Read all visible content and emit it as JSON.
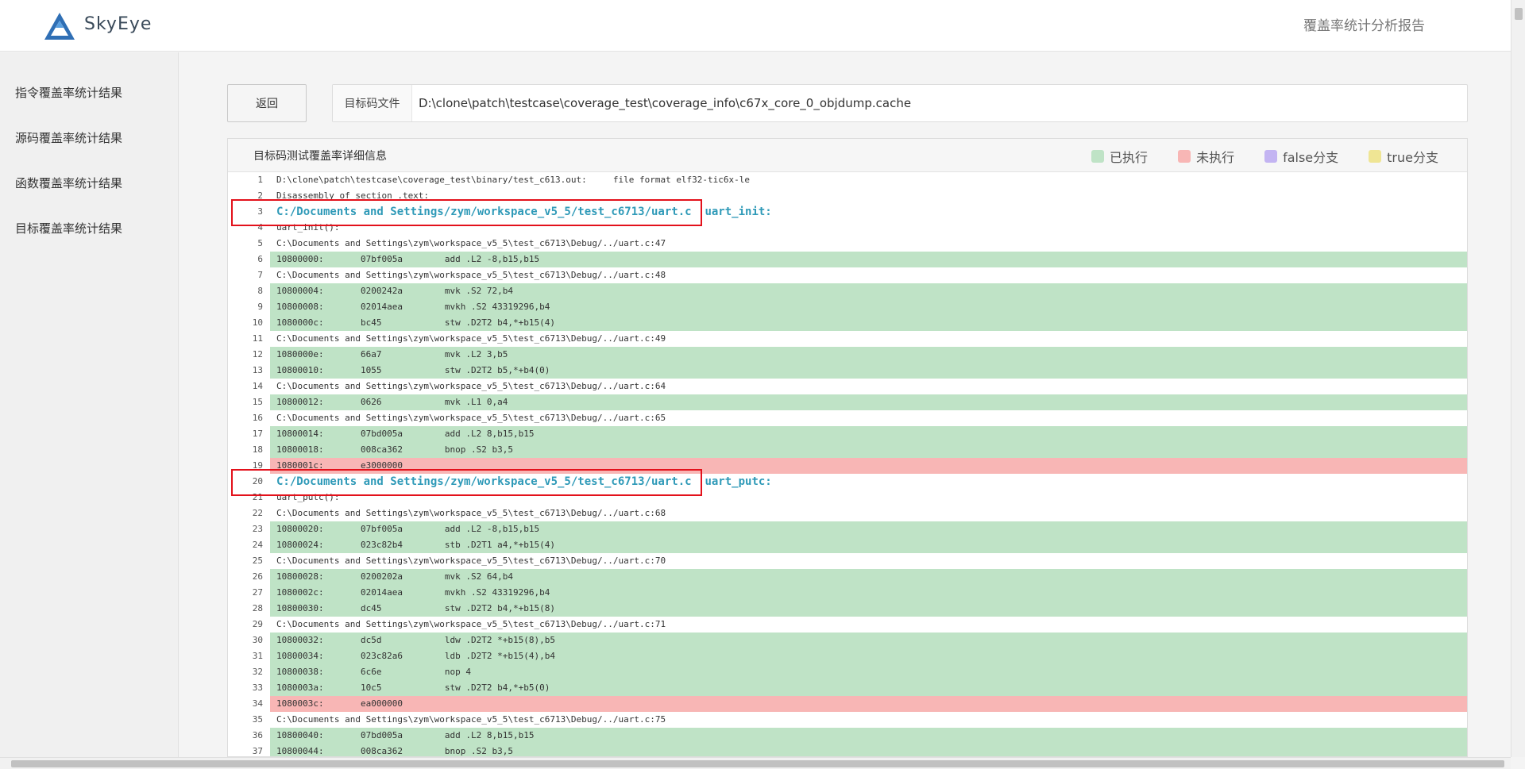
{
  "header": {
    "brand": "SkyEye",
    "report_title": "覆盖率统计分析报告"
  },
  "sidebar": {
    "items": [
      {
        "label": "指令覆盖率统计结果"
      },
      {
        "label": "源码覆盖率统计结果"
      },
      {
        "label": "函数覆盖率统计结果"
      },
      {
        "label": "目标覆盖率统计结果"
      }
    ]
  },
  "toolbar": {
    "back_label": "返回",
    "file_label": "目标码文件",
    "file_path": "D:\\clone\\patch\\testcase\\coverage_test\\coverage_info\\c67x_core_0_objdump.cache"
  },
  "panel": {
    "title": "目标码测试覆盖率详细信息",
    "legend": [
      {
        "label": "已执行",
        "color": "#bfe3c6"
      },
      {
        "label": "未执行",
        "color": "#f8b6b5"
      },
      {
        "label": "false分支",
        "color": "#c3b4f2"
      },
      {
        "label": "true分支",
        "color": "#efe594"
      }
    ]
  },
  "colors": {
    "executed": "#bfe3c6",
    "not_executed": "#f8b6b5",
    "highlight_border": "#e3111b",
    "function_text": "#2f9ab8"
  },
  "code_lines": [
    {
      "n": "1",
      "t": "D:\\clone\\patch\\testcase\\coverage_test\\binary/test_c613.out:     file format elf32-tic6x-le",
      "s": "plain"
    },
    {
      "n": "2",
      "t": "Disassembly of section .text:",
      "s": "plain"
    },
    {
      "n": "3",
      "t": "C:/Documents and Settings/zym/workspace_v5_5/test_c6713/uart.c  uart_init:",
      "s": "func"
    },
    {
      "n": "4",
      "t": "uart_init():",
      "s": "plain"
    },
    {
      "n": "5",
      "t": "C:\\Documents and Settings\\zym\\workspace_v5_5\\test_c6713\\Debug/../uart.c:47",
      "s": "plain"
    },
    {
      "n": "6",
      "t": "10800000:       07bf005a        add .L2 -8,b15,b15",
      "s": "exec"
    },
    {
      "n": "7",
      "t": "C:\\Documents and Settings\\zym\\workspace_v5_5\\test_c6713\\Debug/../uart.c:48",
      "s": "plain"
    },
    {
      "n": "8",
      "t": "10800004:       0200242a        mvk .S2 72,b4",
      "s": "exec"
    },
    {
      "n": "9",
      "t": "10800008:       02014aea        mvkh .S2 43319296,b4",
      "s": "exec"
    },
    {
      "n": "10",
      "t": "1080000c:       bc45            stw .D2T2 b4,*+b15(4)",
      "s": "exec"
    },
    {
      "n": "11",
      "t": "C:\\Documents and Settings\\zym\\workspace_v5_5\\test_c6713\\Debug/../uart.c:49",
      "s": "plain"
    },
    {
      "n": "12",
      "t": "1080000e:       66a7            mvk .L2 3,b5",
      "s": "exec"
    },
    {
      "n": "13",
      "t": "10800010:       1055            stw .D2T2 b5,*+b4(0)",
      "s": "exec"
    },
    {
      "n": "14",
      "t": "C:\\Documents and Settings\\zym\\workspace_v5_5\\test_c6713\\Debug/../uart.c:64",
      "s": "plain"
    },
    {
      "n": "15",
      "t": "10800012:       0626            mvk .L1 0,a4",
      "s": "exec"
    },
    {
      "n": "16",
      "t": "C:\\Documents and Settings\\zym\\workspace_v5_5\\test_c6713\\Debug/../uart.c:65",
      "s": "plain"
    },
    {
      "n": "17",
      "t": "10800014:       07bd005a        add .L2 8,b15,b15",
      "s": "exec"
    },
    {
      "n": "18",
      "t": "10800018:       008ca362        bnop .S2 b3,5",
      "s": "exec"
    },
    {
      "n": "19",
      "t": "1080001c:       e3000000",
      "s": "noexec"
    },
    {
      "n": "20",
      "t": "C:/Documents and Settings/zym/workspace_v5_5/test_c6713/uart.c  uart_putc:",
      "s": "func"
    },
    {
      "n": "21",
      "t": "uart_putc():",
      "s": "plain"
    },
    {
      "n": "22",
      "t": "C:\\Documents and Settings\\zym\\workspace_v5_5\\test_c6713\\Debug/../uart.c:68",
      "s": "plain"
    },
    {
      "n": "23",
      "t": "10800020:       07bf005a        add .L2 -8,b15,b15",
      "s": "exec"
    },
    {
      "n": "24",
      "t": "10800024:       023c82b4        stb .D2T1 a4,*+b15(4)",
      "s": "exec"
    },
    {
      "n": "25",
      "t": "C:\\Documents and Settings\\zym\\workspace_v5_5\\test_c6713\\Debug/../uart.c:70",
      "s": "plain"
    },
    {
      "n": "26",
      "t": "10800028:       0200202a        mvk .S2 64,b4",
      "s": "exec"
    },
    {
      "n": "27",
      "t": "1080002c:       02014aea        mvkh .S2 43319296,b4",
      "s": "exec"
    },
    {
      "n": "28",
      "t": "10800030:       dc45            stw .D2T2 b4,*+b15(8)",
      "s": "exec"
    },
    {
      "n": "29",
      "t": "C:\\Documents and Settings\\zym\\workspace_v5_5\\test_c6713\\Debug/../uart.c:71",
      "s": "plain"
    },
    {
      "n": "30",
      "t": "10800032:       dc5d            ldw .D2T2 *+b15(8),b5",
      "s": "exec"
    },
    {
      "n": "31",
      "t": "10800034:       023c82a6        ldb .D2T2 *+b15(4),b4",
      "s": "exec"
    },
    {
      "n": "32",
      "t": "10800038:       6c6e            nop 4",
      "s": "exec"
    },
    {
      "n": "33",
      "t": "1080003a:       10c5            stw .D2T2 b4,*+b5(0)",
      "s": "exec"
    },
    {
      "n": "34",
      "t": "1080003c:       ea000000",
      "s": "noexec"
    },
    {
      "n": "35",
      "t": "C:\\Documents and Settings\\zym\\workspace_v5_5\\test_c6713\\Debug/../uart.c:75",
      "s": "plain"
    },
    {
      "n": "36",
      "t": "10800040:       07bd005a        add .L2 8,b15,b15",
      "s": "exec"
    },
    {
      "n": "37",
      "t": "10800044:       008ca362        bnop .S2 b3,5",
      "s": "exec"
    }
  ]
}
